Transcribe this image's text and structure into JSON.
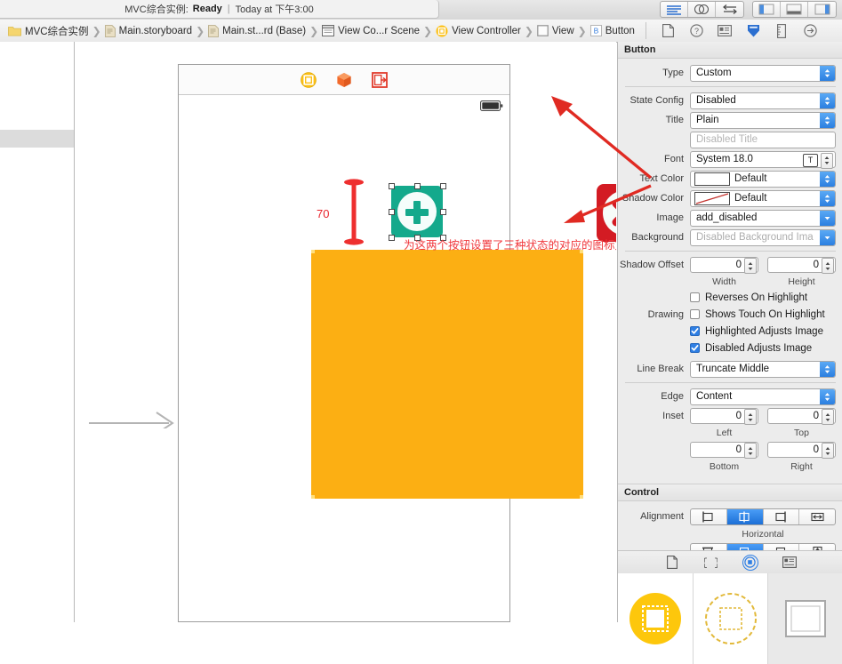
{
  "titlebar": {
    "project": "MVC综合实例:",
    "state": "Ready",
    "separator": "|",
    "time": "Today at 下午3:00",
    "editor_modes": [
      "standard-editor-icon",
      "assistant-editor-icon",
      "version-editor-icon"
    ],
    "view_toggles": [
      "navigator-toggle-icon",
      "debug-area-toggle-icon",
      "utilities-toggle-icon"
    ]
  },
  "breadcrumb": [
    {
      "label": "MVC综合实例",
      "icon": "folder-icon"
    },
    {
      "label": "Main.storyboard",
      "icon": "storyboard-file-icon"
    },
    {
      "label": "Main.st...rd (Base)",
      "icon": "storyboard-file-icon"
    },
    {
      "label": "View Co...r Scene",
      "icon": "scene-icon"
    },
    {
      "label": "View Controller",
      "icon": "view-controller-icon"
    },
    {
      "label": "View",
      "icon": "view-icon"
    },
    {
      "label": "Button",
      "icon": "button-icon"
    }
  ],
  "inspector_tabs": [
    "file-inspector-icon",
    "quick-help-icon",
    "identity-inspector-icon",
    "attributes-inspector-icon",
    "size-inspector-icon",
    "connections-inspector-icon"
  ],
  "canvas": {
    "scene_dock": [
      "view-controller-icon",
      "first-responder-icon",
      "exit-icon"
    ],
    "status_bar_icon": "battery-icon",
    "add_button": {
      "name": "add-button",
      "color": "#14a98c",
      "glyph": "plus"
    },
    "delete_button": {
      "name": "delete-button",
      "color": "#d31b23",
      "glyph": "x"
    },
    "dimension_label": "70",
    "annotation_text": "为这两个按钮设置了三种状态的对应的图标文件",
    "annotation_color": "#f0383d",
    "image_view_color": "#fcaf13"
  },
  "inspector": {
    "button_section": {
      "title": "Button",
      "type": {
        "label": "Type",
        "value": "Custom"
      },
      "state_config": {
        "label": "State Config",
        "value": "Disabled"
      },
      "title_style": {
        "label": "Title",
        "value": "Plain"
      },
      "title_text": {
        "label": "",
        "placeholder": "Disabled Title",
        "value": ""
      },
      "font": {
        "label": "Font",
        "value": "System 18.0"
      },
      "text_color": {
        "label": "Text Color",
        "value": "Default"
      },
      "shadow_color": {
        "label": "Shadow Color",
        "value": "Default"
      },
      "image": {
        "label": "Image",
        "value": "add_disabled"
      },
      "background": {
        "label": "Background",
        "placeholder": "Disabled Background Ima",
        "value": ""
      },
      "shadow_offset": {
        "label": "Shadow Offset",
        "width": {
          "value": "0",
          "sublabel": "Width"
        },
        "height": {
          "value": "0",
          "sublabel": "Height"
        }
      },
      "drawing": {
        "label": "Drawing",
        "options": [
          {
            "label": "Reverses On Highlight",
            "checked": false
          },
          {
            "label": "Shows Touch On Highlight",
            "checked": false
          },
          {
            "label": "Highlighted Adjusts Image",
            "checked": true
          },
          {
            "label": "Disabled Adjusts Image",
            "checked": true
          }
        ]
      },
      "line_break": {
        "label": "Line Break",
        "value": "Truncate Middle"
      },
      "edge": {
        "label": "Edge",
        "value": "Content"
      },
      "inset": {
        "label": "Inset",
        "left": {
          "value": "0",
          "sublabel": "Left"
        },
        "top": {
          "value": "0",
          "sublabel": "Top"
        },
        "bottom": {
          "value": "0",
          "sublabel": "Bottom"
        },
        "right": {
          "value": "0",
          "sublabel": "Right"
        }
      }
    },
    "control_section": {
      "title": "Control",
      "alignment_label": "Alignment",
      "horizontal_sublabel": "Horizontal",
      "horizontal_options": [
        "align-left-icon",
        "align-center-icon",
        "align-right-icon",
        "align-fill-horizontal-icon"
      ],
      "horizontal_selected": 1,
      "vertical_options": [
        "align-top-icon",
        "align-middle-icon",
        "align-bottom-icon",
        "align-fill-vertical-icon"
      ],
      "vertical_selected": 1
    },
    "library_tabs": [
      "file-template-library-icon",
      "code-snippet-library-icon",
      "object-library-icon",
      "media-library-icon"
    ],
    "library_selected": 2,
    "library_items": [
      "view-controller-object-icon",
      "storyboard-reference-icon",
      "view-object-icon"
    ]
  },
  "accent_colors": {
    "blue": "#2b7fe0",
    "red_annotation": "#f0383d",
    "teal": "#14a98c",
    "orange": "#fcaf13"
  }
}
